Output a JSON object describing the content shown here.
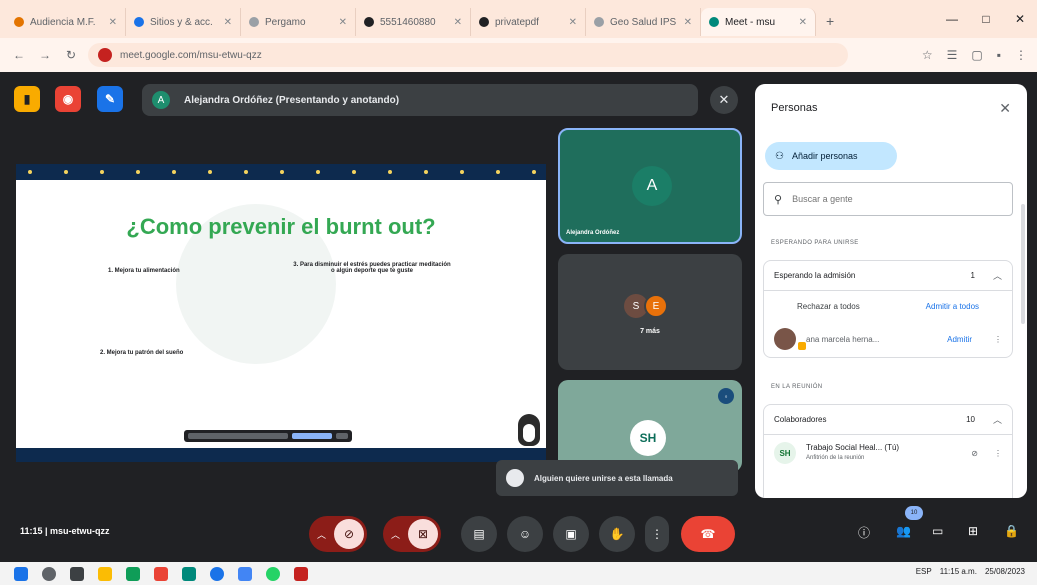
{
  "browser": {
    "tabs": [
      {
        "label": "Audiencia M.F.",
        "color": "#e37400"
      },
      {
        "label": "Sitios y & acc.",
        "color": "#1a73e8"
      },
      {
        "label": "Pergamo",
        "color": "#9aa0a6"
      },
      {
        "label": "5551460880",
        "color": "#202124"
      },
      {
        "label": "privatepdf",
        "color": "#202124"
      },
      {
        "label": "Geo Salud IPS",
        "color": "#9aa0a6"
      },
      {
        "label": "Meet - msu",
        "color": "#00897b"
      }
    ],
    "url": "meet.google.com/msu-etwu-qzz",
    "new_tab": "+",
    "window_controls": [
      "—",
      "□",
      "✕"
    ],
    "nav_icons": [
      "←",
      "→",
      "↻"
    ],
    "right_icons": [
      "☆",
      "☰",
      "▢",
      "▪",
      "⋮"
    ]
  },
  "meet": {
    "presenter": {
      "initial": "A",
      "label": "Alejandra Ordóñez (Presentando y anotando)"
    },
    "slide": {
      "title": "¿Como prevenir el burnt out?",
      "item1": "1. Mejora tu alimentación",
      "item2": "3. Para disminuir el estrés puedes practicar meditación o algún deporte que te guste",
      "item3": "2. Mejora tu patrón del sueño"
    },
    "tiles": {
      "tile1": {
        "initial": "A",
        "name": "Alejandra Ordóñez"
      },
      "tile2": {
        "initial1": "S",
        "initial2": "E",
        "more": "7 más"
      },
      "tile3": {
        "logo": "SH"
      }
    },
    "toast": "Alguien quiere unirse a esta llamada",
    "meeting_code": "11:15  |  msu-etwu-qzz",
    "people_count": "10"
  },
  "panel": {
    "title": "Personas",
    "close": "✕",
    "add_people": "Añadir personas",
    "search_placeholder": "Buscar a gente",
    "waiting_section": "ESPERANDO PARA UNIRSE",
    "waiting_box": {
      "title": "Esperando la admisión",
      "count": "1",
      "reject_all": "Rechazar a todos",
      "admit_all": "Admitir a todos",
      "person_name": "ana marcela herna...",
      "admit": "Admitir"
    },
    "in_meeting_section": "EN LA REUNIÓN",
    "collab_box": {
      "title": "Colaboradores",
      "count": "10",
      "person_line1": "Trabajo Social Heal...  (Tú)",
      "person_line2": "Anfitrión de la reunión",
      "person_initial": "SH"
    }
  },
  "taskbar": {
    "lang": "ESP",
    "time": "11:15 a.m.",
    "date": "25/08/2023",
    "app_colors": [
      "#1a73e8",
      "#fbbc04",
      "#0f9d58",
      "#ea4335",
      "#00897b",
      "#1a73e8",
      "#4285f4",
      "#25d366",
      "#c5221f"
    ]
  }
}
